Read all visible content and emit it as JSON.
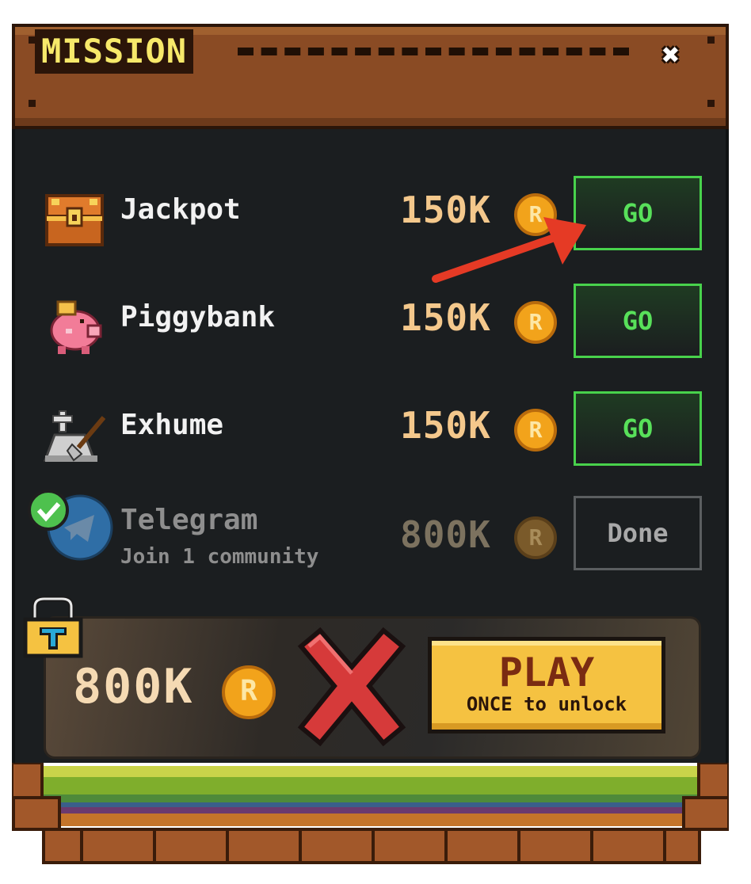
{
  "header": {
    "title": "MISSION",
    "close_icon": "close-icon"
  },
  "missions": [
    {
      "name": "Jackpot",
      "reward": "150K",
      "coin_symbol": "R",
      "action": "GO",
      "icon": "treasure-chest-icon"
    },
    {
      "name": "Piggybank",
      "reward": "150K",
      "coin_symbol": "R",
      "action": "GO",
      "icon": "piggy-bank-icon"
    },
    {
      "name": "Exhume",
      "reward": "150K",
      "coin_symbol": "R",
      "action": "GO",
      "icon": "tombstone-shovel-icon"
    },
    {
      "name": "Telegram",
      "subtitle": "Join 1 community",
      "reward": "800K",
      "coin_symbol": "R",
      "action": "Done",
      "icon": "telegram-icon",
      "completed": true
    }
  ],
  "unlock": {
    "reward": "800K",
    "coin_symbol": "R",
    "play_label": "PLAY",
    "play_sub": "ONCE to unlock",
    "lock_icon": "padlock-icon",
    "cross_icon": "red-x-icon"
  },
  "colors": {
    "go_green": "#48d24c",
    "reward_gold": "#f4c88c",
    "wood": "#8a4b24",
    "panel": "#1b1e20",
    "arrow": "#e53a25"
  }
}
